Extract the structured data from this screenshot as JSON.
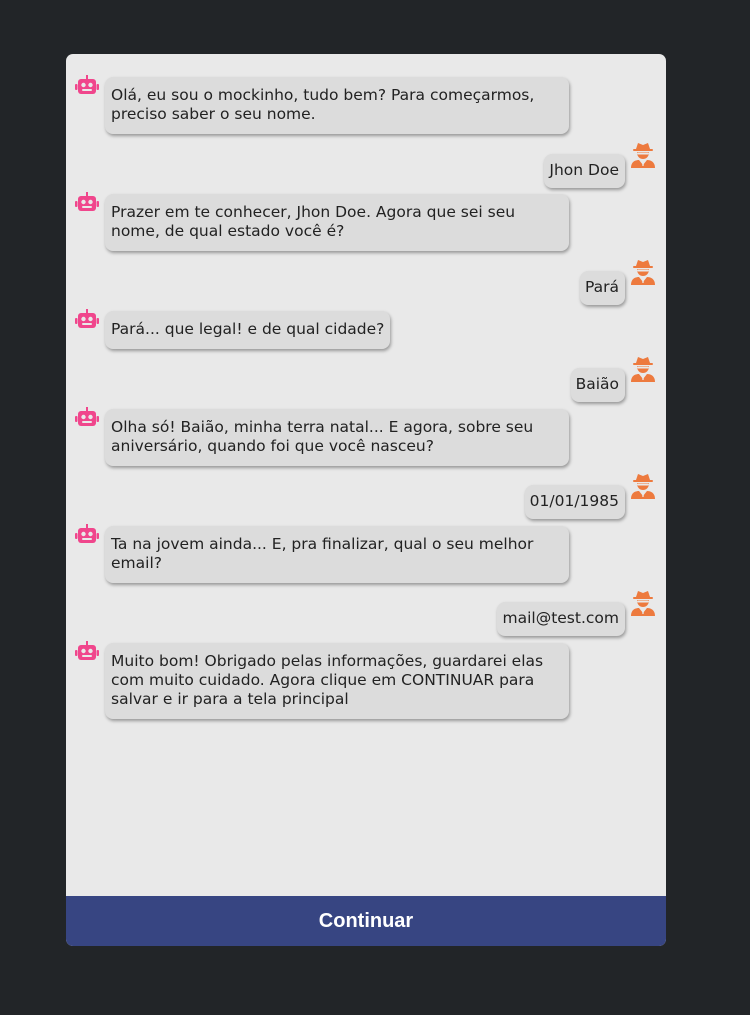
{
  "colors": {
    "page_background": "#222528",
    "chat_background": "#e9e9e9",
    "bubble_background": "#dcdcdc",
    "bot_icon": "#f0468c",
    "user_icon": "#ed7a3e",
    "button_background": "#374582"
  },
  "icons": {
    "bot": "robot-icon",
    "user": "user-secret-icon"
  },
  "conversation": {
    "messages": [
      {
        "from": "bot",
        "text": "Olá, eu sou o mockinho, tudo bem? Para começarmos, preciso saber o seu nome."
      },
      {
        "from": "user",
        "text": "Jhon Doe"
      },
      {
        "from": "bot",
        "text": "Prazer em te conhecer, Jhon Doe. Agora que sei seu nome, de qual estado você é?"
      },
      {
        "from": "user",
        "text": "Pará"
      },
      {
        "from": "bot",
        "text": "Pará... que legal! e de qual cidade?"
      },
      {
        "from": "user",
        "text": "Baião"
      },
      {
        "from": "bot",
        "text": "Olha só! Baião, minha terra natal... E agora, sobre seu aniversário, quando foi que você nasceu?"
      },
      {
        "from": "user",
        "text": "01/01/1985"
      },
      {
        "from": "bot",
        "text": "Ta na jovem ainda... E, pra finalizar, qual o seu melhor email?"
      },
      {
        "from": "user",
        "text": "mail@test.com"
      },
      {
        "from": "bot",
        "text": "Muito bom! Obrigado pelas informações, guardarei elas com muito cuidado. Agora clique em CONTINUAR para salvar e ir para a tela principal"
      }
    ]
  },
  "footer": {
    "continue_label": "Continuar"
  }
}
